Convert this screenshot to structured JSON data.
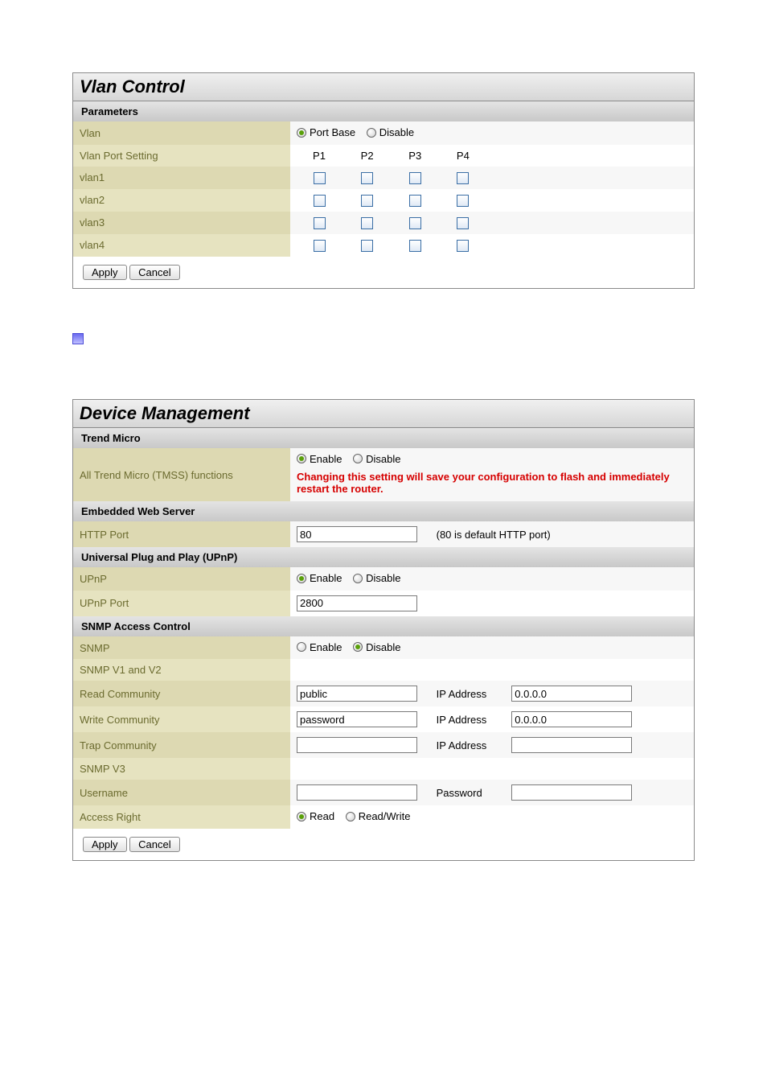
{
  "vlan": {
    "title": "Vlan Control",
    "section": "Parameters",
    "rows": {
      "vlan_label": "Vlan",
      "port_base": "Port Base",
      "disable": "Disable",
      "port_setting": "Vlan Port Setting",
      "ports": [
        "P1",
        "P2",
        "P3",
        "P4"
      ],
      "vlan_names": [
        "vlan1",
        "vlan2",
        "vlan3",
        "vlan4"
      ]
    },
    "apply": "Apply",
    "cancel": "Cancel"
  },
  "device": {
    "title": "Device Management",
    "trend_h": "Trend Micro",
    "all_tmss": "All Trend Micro (TMSS) functions",
    "enable": "Enable",
    "disable": "Disable",
    "warn": "Changing this setting will save your configuration to flash and immediately restart the router.",
    "ews_h": "Embedded Web Server",
    "http_port_label": "HTTP Port",
    "http_port_value": "80",
    "http_port_note": "(80 is default HTTP port)",
    "upnp_h": "Universal Plug and Play (UPnP)",
    "upnp_label": "UPnP",
    "upnp_port_label": "UPnP Port",
    "upnp_port_value": "2800",
    "snmp_h": "SNMP Access Control",
    "snmp_label": "SNMP",
    "snmp_v1v2": "SNMP V1 and V2",
    "read_comm": "Read Community",
    "read_comm_val": "public",
    "write_comm": "Write Community",
    "write_comm_val": "password",
    "trap_comm": "Trap Community",
    "trap_comm_val": "",
    "ip_address": "IP Address",
    "ip_val1": "0.0.0.0",
    "ip_val2": "0.0.0.0",
    "ip_val3": "",
    "snmp_v3": "SNMP V3",
    "username": "Username",
    "username_val": "",
    "password": "Password",
    "password_val": "",
    "access_right": "Access Right",
    "read": "Read",
    "readwrite": "Read/Write",
    "apply": "Apply",
    "cancel": "Cancel"
  }
}
